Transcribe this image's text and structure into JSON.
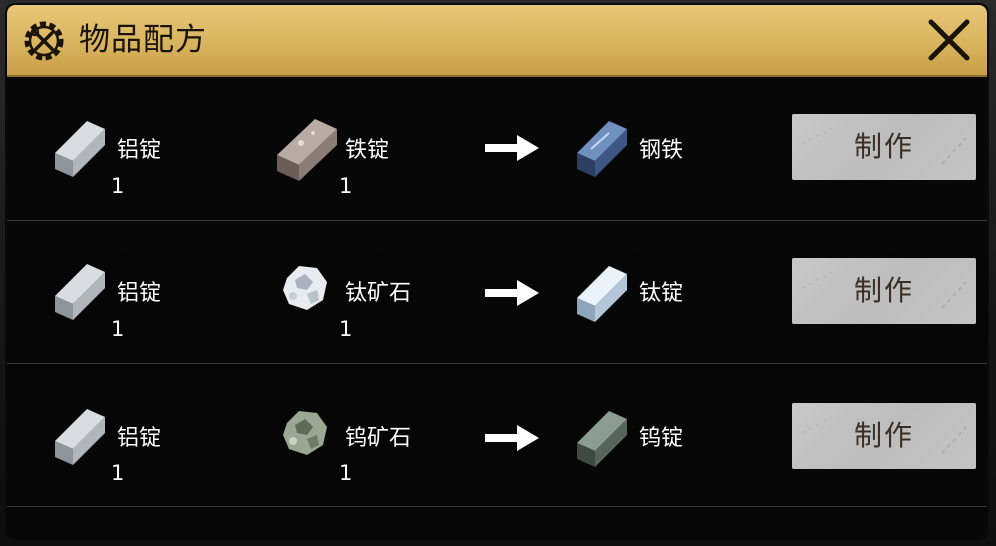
{
  "window": {
    "title": "物品配方",
    "title_icon": "wrench-screwdriver-gear-icon",
    "close_icon": "close-icon"
  },
  "recipes": [
    {
      "input1": {
        "name": "铝锭",
        "qty": "1",
        "icon": "aluminum-ingot-icon"
      },
      "input2": {
        "name": "铁锭",
        "qty": "1",
        "icon": "iron-ingot-icon"
      },
      "output": {
        "name": "钢铁",
        "icon": "steel-ingot-icon"
      },
      "craft_label": "制作"
    },
    {
      "input1": {
        "name": "铝锭",
        "qty": "1",
        "icon": "aluminum-ingot-icon"
      },
      "input2": {
        "name": "钛矿石",
        "qty": "1",
        "icon": "titanium-ore-icon"
      },
      "output": {
        "name": "钛锭",
        "icon": "titanium-ingot-icon"
      },
      "craft_label": "制作"
    },
    {
      "input1": {
        "name": "铝锭",
        "qty": "1",
        "icon": "aluminum-ingot-icon"
      },
      "input2": {
        "name": "钨矿石",
        "qty": "1",
        "icon": "tungsten-ore-icon"
      },
      "output": {
        "name": "钨锭",
        "icon": "tungsten-ingot-icon"
      },
      "craft_label": "制作"
    }
  ],
  "colors": {
    "titlebar": "#d9b45e",
    "panel_bg": "#050505",
    "craft_button": "#c4c4c4",
    "craft_text": "#3a2f24"
  }
}
